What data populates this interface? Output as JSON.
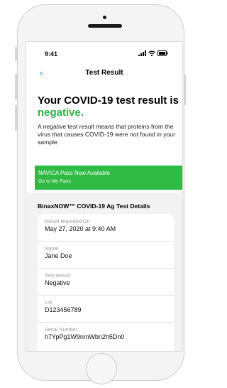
{
  "status_bar": {
    "time": "9:41"
  },
  "nav": {
    "back_icon": "chevron-left-icon",
    "title": "Test Result"
  },
  "result": {
    "heading_prefix": "Your COVID-19 test result is",
    "heading_result": "negative.",
    "result_color": "#2bb34a",
    "description": "A negative test result means that proteins from the virus that causes COVID-19 were not found in your sample."
  },
  "banner": {
    "title": "NAVICA Pass Now Available",
    "link": "Go to My Pass",
    "color": "#2fba44"
  },
  "details": {
    "title": "BinaxNOW™ COVID-19 Ag Test Details",
    "fields": [
      {
        "label": "Result Reported On",
        "value": "May 27, 2020 at 9:40 AM"
      },
      {
        "label": "Name",
        "value": "Jane Doe"
      },
      {
        "label": "Test Result",
        "value": "Negative"
      },
      {
        "label": "Lot",
        "value": "D123456789"
      },
      {
        "label": "Serial Number",
        "value": "h7YpPg1W9nmWbn2h5Dn0"
      }
    ]
  }
}
